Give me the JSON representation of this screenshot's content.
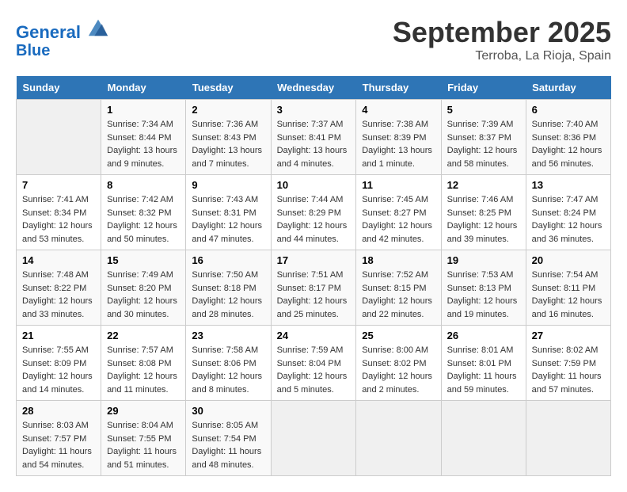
{
  "logo": {
    "line1": "General",
    "line2": "Blue"
  },
  "title": "September 2025",
  "location": "Terroba, La Rioja, Spain",
  "weekdays": [
    "Sunday",
    "Monday",
    "Tuesday",
    "Wednesday",
    "Thursday",
    "Friday",
    "Saturday"
  ],
  "weeks": [
    [
      {
        "num": "",
        "info": ""
      },
      {
        "num": "1",
        "info": "Sunrise: 7:34 AM\nSunset: 8:44 PM\nDaylight: 13 hours\nand 9 minutes."
      },
      {
        "num": "2",
        "info": "Sunrise: 7:36 AM\nSunset: 8:43 PM\nDaylight: 13 hours\nand 7 minutes."
      },
      {
        "num": "3",
        "info": "Sunrise: 7:37 AM\nSunset: 8:41 PM\nDaylight: 13 hours\nand 4 minutes."
      },
      {
        "num": "4",
        "info": "Sunrise: 7:38 AM\nSunset: 8:39 PM\nDaylight: 13 hours\nand 1 minute."
      },
      {
        "num": "5",
        "info": "Sunrise: 7:39 AM\nSunset: 8:37 PM\nDaylight: 12 hours\nand 58 minutes."
      },
      {
        "num": "6",
        "info": "Sunrise: 7:40 AM\nSunset: 8:36 PM\nDaylight: 12 hours\nand 56 minutes."
      }
    ],
    [
      {
        "num": "7",
        "info": "Sunrise: 7:41 AM\nSunset: 8:34 PM\nDaylight: 12 hours\nand 53 minutes."
      },
      {
        "num": "8",
        "info": "Sunrise: 7:42 AM\nSunset: 8:32 PM\nDaylight: 12 hours\nand 50 minutes."
      },
      {
        "num": "9",
        "info": "Sunrise: 7:43 AM\nSunset: 8:31 PM\nDaylight: 12 hours\nand 47 minutes."
      },
      {
        "num": "10",
        "info": "Sunrise: 7:44 AM\nSunset: 8:29 PM\nDaylight: 12 hours\nand 44 minutes."
      },
      {
        "num": "11",
        "info": "Sunrise: 7:45 AM\nSunset: 8:27 PM\nDaylight: 12 hours\nand 42 minutes."
      },
      {
        "num": "12",
        "info": "Sunrise: 7:46 AM\nSunset: 8:25 PM\nDaylight: 12 hours\nand 39 minutes."
      },
      {
        "num": "13",
        "info": "Sunrise: 7:47 AM\nSunset: 8:24 PM\nDaylight: 12 hours\nand 36 minutes."
      }
    ],
    [
      {
        "num": "14",
        "info": "Sunrise: 7:48 AM\nSunset: 8:22 PM\nDaylight: 12 hours\nand 33 minutes."
      },
      {
        "num": "15",
        "info": "Sunrise: 7:49 AM\nSunset: 8:20 PM\nDaylight: 12 hours\nand 30 minutes."
      },
      {
        "num": "16",
        "info": "Sunrise: 7:50 AM\nSunset: 8:18 PM\nDaylight: 12 hours\nand 28 minutes."
      },
      {
        "num": "17",
        "info": "Sunrise: 7:51 AM\nSunset: 8:17 PM\nDaylight: 12 hours\nand 25 minutes."
      },
      {
        "num": "18",
        "info": "Sunrise: 7:52 AM\nSunset: 8:15 PM\nDaylight: 12 hours\nand 22 minutes."
      },
      {
        "num": "19",
        "info": "Sunrise: 7:53 AM\nSunset: 8:13 PM\nDaylight: 12 hours\nand 19 minutes."
      },
      {
        "num": "20",
        "info": "Sunrise: 7:54 AM\nSunset: 8:11 PM\nDaylight: 12 hours\nand 16 minutes."
      }
    ],
    [
      {
        "num": "21",
        "info": "Sunrise: 7:55 AM\nSunset: 8:09 PM\nDaylight: 12 hours\nand 14 minutes."
      },
      {
        "num": "22",
        "info": "Sunrise: 7:57 AM\nSunset: 8:08 PM\nDaylight: 12 hours\nand 11 minutes."
      },
      {
        "num": "23",
        "info": "Sunrise: 7:58 AM\nSunset: 8:06 PM\nDaylight: 12 hours\nand 8 minutes."
      },
      {
        "num": "24",
        "info": "Sunrise: 7:59 AM\nSunset: 8:04 PM\nDaylight: 12 hours\nand 5 minutes."
      },
      {
        "num": "25",
        "info": "Sunrise: 8:00 AM\nSunset: 8:02 PM\nDaylight: 12 hours\nand 2 minutes."
      },
      {
        "num": "26",
        "info": "Sunrise: 8:01 AM\nSunset: 8:01 PM\nDaylight: 11 hours\nand 59 minutes."
      },
      {
        "num": "27",
        "info": "Sunrise: 8:02 AM\nSunset: 7:59 PM\nDaylight: 11 hours\nand 57 minutes."
      }
    ],
    [
      {
        "num": "28",
        "info": "Sunrise: 8:03 AM\nSunset: 7:57 PM\nDaylight: 11 hours\nand 54 minutes."
      },
      {
        "num": "29",
        "info": "Sunrise: 8:04 AM\nSunset: 7:55 PM\nDaylight: 11 hours\nand 51 minutes."
      },
      {
        "num": "30",
        "info": "Sunrise: 8:05 AM\nSunset: 7:54 PM\nDaylight: 11 hours\nand 48 minutes."
      },
      {
        "num": "",
        "info": ""
      },
      {
        "num": "",
        "info": ""
      },
      {
        "num": "",
        "info": ""
      },
      {
        "num": "",
        "info": ""
      }
    ]
  ]
}
